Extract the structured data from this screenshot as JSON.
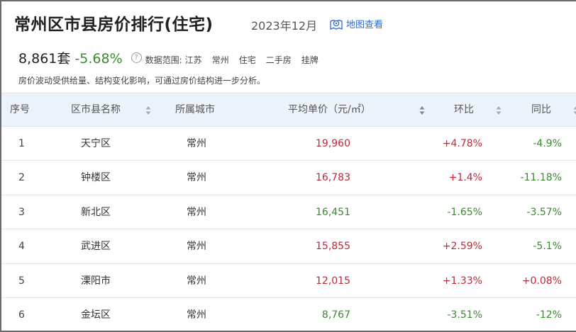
{
  "header": {
    "title": "常州区市县房价排行(住宅)",
    "date": "2023年12月",
    "map_link": "地图查看"
  },
  "summary": {
    "total": "8,861套",
    "change": "-5.68%",
    "help_icon": "?",
    "scope_label": "数据范围:",
    "scope_items": [
      "江苏",
      "常州",
      "住宅",
      "二手房",
      "挂牌"
    ]
  },
  "note": "房价波动受供给量、结构变化影响，可通过房价结构进一步分析。",
  "table": {
    "columns": {
      "index": "序号",
      "name": "区市县名称",
      "city": "所属城市",
      "price": "平均单价（元/㎡）",
      "mom": "环比",
      "yoy": "同比"
    },
    "rows": [
      {
        "index": "1",
        "name": "天宁区",
        "city": "常州",
        "price": "19,960",
        "price_dir": "up",
        "mom": "+4.78%",
        "mom_dir": "up",
        "yoy": "-4.9%",
        "yoy_dir": "down"
      },
      {
        "index": "2",
        "name": "钟楼区",
        "city": "常州",
        "price": "16,783",
        "price_dir": "up",
        "mom": "+1.4%",
        "mom_dir": "up",
        "yoy": "-11.18%",
        "yoy_dir": "down"
      },
      {
        "index": "3",
        "name": "新北区",
        "city": "常州",
        "price": "16,451",
        "price_dir": "down",
        "mom": "-1.65%",
        "mom_dir": "down",
        "yoy": "-3.57%",
        "yoy_dir": "down"
      },
      {
        "index": "4",
        "name": "武进区",
        "city": "常州",
        "price": "15,855",
        "price_dir": "up",
        "mom": "+2.59%",
        "mom_dir": "up",
        "yoy": "-5.1%",
        "yoy_dir": "down"
      },
      {
        "index": "5",
        "name": "溧阳市",
        "city": "常州",
        "price": "12,015",
        "price_dir": "up",
        "mom": "+1.33%",
        "mom_dir": "up",
        "yoy": "+0.08%",
        "yoy_dir": "up"
      },
      {
        "index": "6",
        "name": "金坛区",
        "city": "常州",
        "price": "8,767",
        "price_dir": "down",
        "mom": "-3.51%",
        "mom_dir": "down",
        "yoy": "-12%",
        "yoy_dir": "down"
      }
    ]
  },
  "colors": {
    "up": "#c0283a",
    "down": "#3a8a2f",
    "link": "#2d6bd6",
    "header_bg": "#edf3fb"
  },
  "icons": {
    "map": "map-pin-icon",
    "sort": "sort-arrows-icon",
    "help": "question-circle-icon"
  }
}
